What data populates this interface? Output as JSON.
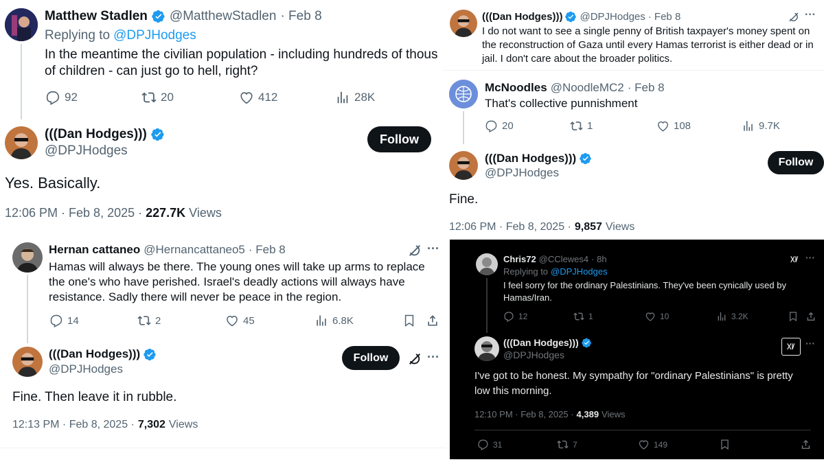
{
  "p1": {
    "reply": {
      "name": "Matthew Stadlen",
      "handle": "@MatthewStadlen",
      "dot_date": "· Feb 8",
      "replying_prefix": "Replying to",
      "replying_handle": "@DPJHodges",
      "text": "In the meantime the civilian population - including hundreds of thous of children - can just go to hell, right?",
      "replies": "92",
      "reposts": "20",
      "likes": "412",
      "views": "28K"
    },
    "main": {
      "name": "(((Dan Hodges)))",
      "handle": "@DPJHodges",
      "follow": "Follow",
      "text": "Yes. Basically.",
      "timestamp": "12:06 PM · Feb 8, 2025 ·",
      "views_count": "227.7K",
      "views_label": "Views"
    }
  },
  "p2": {
    "tweet": {
      "name": "(((Dan Hodges)))",
      "handle": "@DPJHodges",
      "dot_date": "· Feb 8",
      "text": "I do not want to see a single penny of British taxpayer's money spent on the reconstruction of Gaza until every Hamas terrorist is either dead or in jail. I don't care about the broader politics."
    },
    "reply": {
      "name": "McNoodles",
      "handle": "@NoodleMC2",
      "dot_date": "· Feb 8",
      "text": "That's collective punnishment",
      "replies": "20",
      "reposts": "1",
      "likes": "108",
      "views": "9.7K"
    },
    "main": {
      "name": "(((Dan Hodges)))",
      "handle": "@DPJHodges",
      "follow": "Follow",
      "text": "Fine.",
      "timestamp": "12:06 PM · Feb 8, 2025 ·",
      "views_count": "9,857",
      "views_label": "Views"
    }
  },
  "p3": {
    "reply": {
      "name": "Hernan cattaneo",
      "handle": "@Hernancattaneo5",
      "dot_date": "· Feb 8",
      "text": "Hamas will always be there. The young ones will take up arms to replace the one's who have perished. Israel's deadly actions will always have resistance. Sadly there will never be peace in the region.",
      "replies": "14",
      "reposts": "2",
      "likes": "45",
      "views": "6.8K"
    },
    "main": {
      "name": "(((Dan Hodges)))",
      "handle": "@DPJHodges",
      "follow": "Follow",
      "text": "Fine. Then leave it in rubble.",
      "timestamp": "12:13 PM · Feb 8, 2025 ·",
      "views_count": "7,302",
      "views_label": "Views"
    }
  },
  "p4": {
    "reply": {
      "name": "Chris72",
      "handle": "@CClewes4",
      "dot_date": "· 8h",
      "replying_prefix": "Replying to",
      "replying_handle": "@DPJHodges",
      "text": "I feel sorry for the ordinary Palestinians.  They've been cynically used by Hamas/Iran.",
      "replies": "12",
      "reposts": "1",
      "likes": "10",
      "views": "3.2K"
    },
    "main": {
      "name": "(((Dan Hodges)))",
      "handle": "@DPJHodges",
      "text": "I've got to be honest. My sympathy for \"ordinary Palestinians\" is pretty low this morning.",
      "timestamp": "12:10 PM · Feb 8, 2025 ·",
      "views_count": "4,389",
      "views_label": "Views",
      "replies": "31",
      "reposts": "7",
      "likes": "149"
    }
  },
  "icons": {
    "more": "···",
    "grok": "grok-icon"
  },
  "colors": {
    "accent": "#1d9bf0",
    "text": "#0f1419",
    "muted": "#536471",
    "dark_bg": "#000000"
  }
}
